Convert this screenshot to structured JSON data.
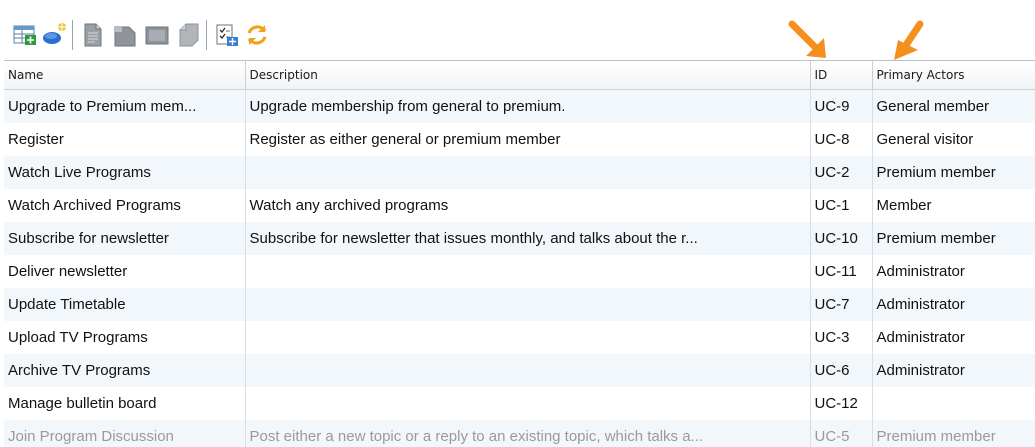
{
  "toolbar": {
    "icons": [
      "table-view-icon",
      "add-entity-icon",
      "doc-icon",
      "doc-folded-icon",
      "doc-wide-icon",
      "doc-dim-icon",
      "checklist-icon",
      "refresh-icon"
    ]
  },
  "colors": {
    "arrow": "#f5901e",
    "row_alt": "#f2f7fc",
    "grid": "#d8dee4"
  },
  "table": {
    "headers": {
      "name": "Name",
      "description": "Description",
      "id": "ID",
      "actors": "Primary Actors"
    },
    "rows": [
      {
        "name": "Upgrade to Premium mem...",
        "description": "Upgrade membership from general to premium.",
        "id": "UC-9",
        "actors": "General member"
      },
      {
        "name": "Register",
        "description": "Register as either general or premium member",
        "id": "UC-8",
        "actors": "General visitor"
      },
      {
        "name": "Watch Live Programs",
        "description": "",
        "id": "UC-2",
        "actors": "Premium member"
      },
      {
        "name": "Watch Archived Programs",
        "description": "Watch any archived programs",
        "id": "UC-1",
        "actors": "Member"
      },
      {
        "name": "Subscribe for newsletter",
        "description": "Subscribe for newsletter that issues monthly, and talks about the r...",
        "id": "UC-10",
        "actors": "Premium member"
      },
      {
        "name": "Deliver newsletter",
        "description": "",
        "id": "UC-11",
        "actors": "Administrator"
      },
      {
        "name": "Update Timetable",
        "description": "",
        "id": "UC-7",
        "actors": "Administrator"
      },
      {
        "name": "Upload TV Programs",
        "description": "",
        "id": "UC-3",
        "actors": "Administrator"
      },
      {
        "name": "Archive TV Programs",
        "description": "",
        "id": "UC-6",
        "actors": "Administrator"
      },
      {
        "name": "Manage bulletin board",
        "description": "",
        "id": "UC-12",
        "actors": ""
      },
      {
        "name": "Join Program Discussion",
        "description": "Post either a new topic or a reply to an existing topic, which talks a...",
        "id": "UC-5",
        "actors": "Premium member"
      }
    ]
  }
}
